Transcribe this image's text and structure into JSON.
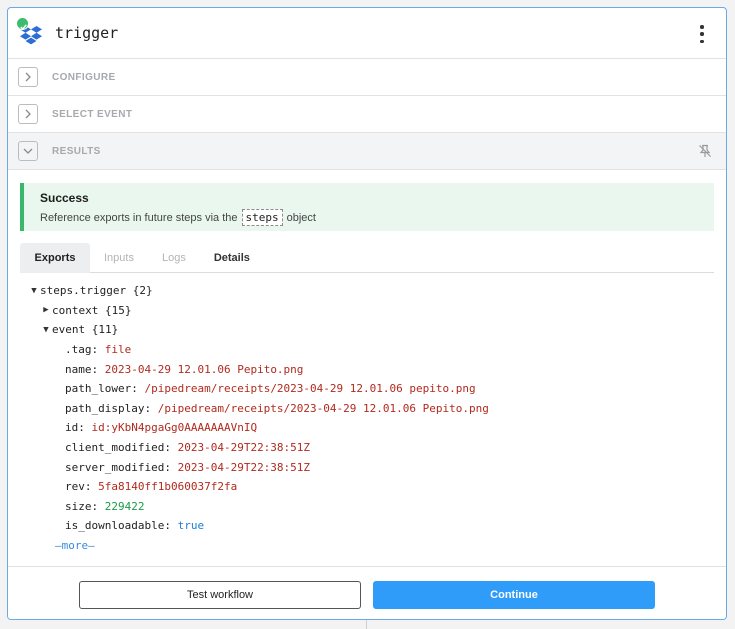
{
  "header": {
    "title": "trigger",
    "app_icon": "dropbox-icon",
    "status_icon": "check-circle-icon",
    "menu_icon": "kebab-menu-icon"
  },
  "sections": {
    "configure": "CONFIGURE",
    "select_event": "SELECT EVENT",
    "results": "RESULTS"
  },
  "success": {
    "title": "Success",
    "text_before": "Reference exports in future steps via the",
    "code": "steps",
    "text_after": "object"
  },
  "tabs": [
    {
      "label": "Exports",
      "active": true
    },
    {
      "label": "Inputs",
      "active": false
    },
    {
      "label": "Logs",
      "active": false
    },
    {
      "label": "Details",
      "active": false
    }
  ],
  "tree": {
    "root": "steps.trigger {2}",
    "context": "context {15}",
    "event": "event {11}",
    "fields": [
      {
        "key": ".tag:",
        "value": "file",
        "type": "str"
      },
      {
        "key": "name:",
        "value": "2023-04-29 12.01.06 Pepito.png",
        "type": "str"
      },
      {
        "key": "path_lower:",
        "value": "/pipedream/receipts/2023-04-29 12.01.06 pepito.png",
        "type": "str"
      },
      {
        "key": "path_display:",
        "value": "/pipedream/receipts/2023-04-29 12.01.06 Pepito.png",
        "type": "str"
      },
      {
        "key": "id:",
        "value": "id:yKbN4pgaGg0AAAAAAAVnIQ",
        "type": "str"
      },
      {
        "key": "client_modified:",
        "value": "2023-04-29T22:38:51Z",
        "type": "str"
      },
      {
        "key": "server_modified:",
        "value": "2023-04-29T22:38:51Z",
        "type": "str"
      },
      {
        "key": "rev:",
        "value": "5fa8140ff1b060037f2fa",
        "type": "str"
      },
      {
        "key": "size:",
        "value": "229422",
        "type": "num"
      },
      {
        "key": "is_downloadable:",
        "value": "true",
        "type": "bool"
      }
    ],
    "more": "—more—"
  },
  "footer": {
    "test_label": "Test workflow",
    "continue_label": "Continue"
  },
  "colors": {
    "accent": "#2e9cf8",
    "success": "#37b86a",
    "string_value": "#b22a1e",
    "number_value": "#1a9b4a",
    "bool_value": "#1d7fd6"
  }
}
